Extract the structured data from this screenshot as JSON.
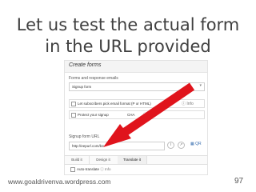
{
  "slide": {
    "title_line1": "Let us test the actual form",
    "title_line2": "in the URL provided",
    "footer_url": "www.goaldrivenva.wordpress.com",
    "page_number": "97",
    "arrow_color": "#e0141c"
  },
  "panel": {
    "header": "Create forms",
    "section_label": "Forms and response emails",
    "form_select": "Signup form",
    "checkbox1_label": "Let subscribers pick email format (P",
    "checkbox1_suffix": "or HTML)",
    "checkbox2_label": "Protect your signup",
    "checkbox2_suffix": "CHA",
    "info_label": "Info",
    "url_label": "Signup form URL",
    "url_value": "http://eepurl.com/b2",
    "qr_label": "QR",
    "tabs": [
      "Build it",
      "Design it",
      "Translate it"
    ],
    "active_tab": "Translate it",
    "auto_translate_label": "Auto-translate",
    "auto_translate_info": "Info"
  }
}
